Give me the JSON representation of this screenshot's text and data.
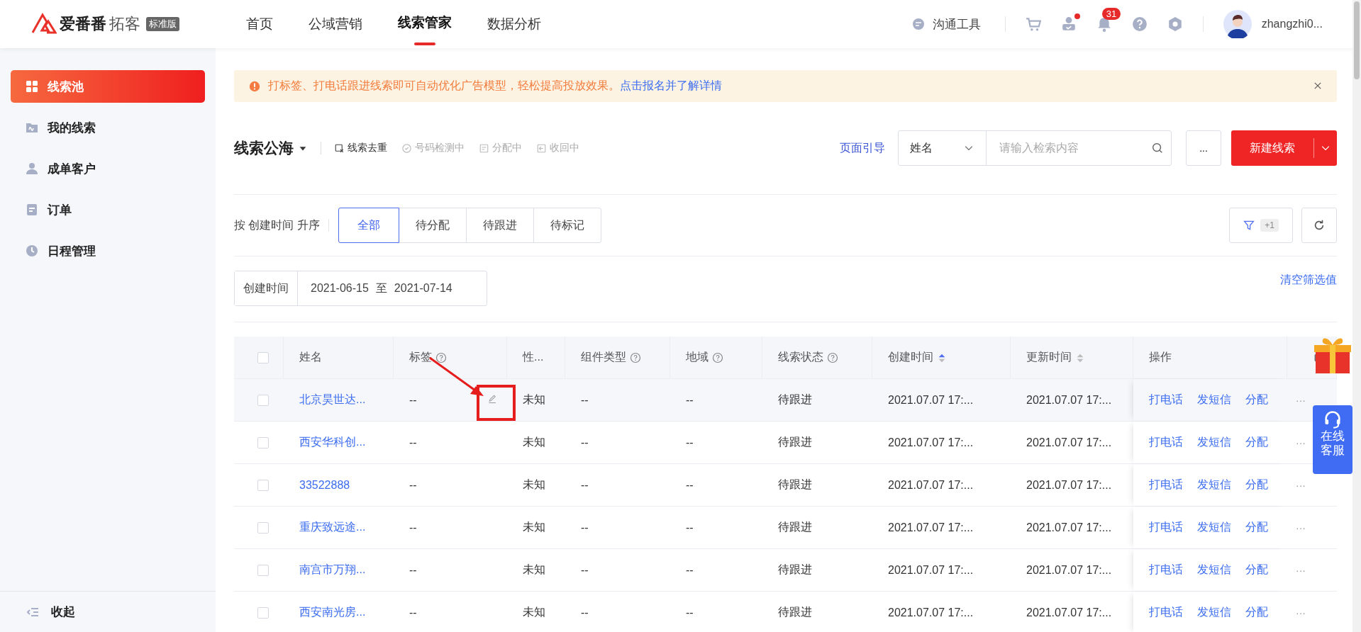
{
  "header": {
    "logo": {
      "brand": "爱番番",
      "product": "拓客",
      "edition": "标准版"
    },
    "nav": [
      {
        "label": "首页",
        "selected": false
      },
      {
        "label": "公域营销",
        "selected": false
      },
      {
        "label": "线索管家",
        "selected": true
      },
      {
        "label": "数据分析",
        "selected": false
      }
    ],
    "comm_tool": "沟通工具",
    "notification_count": "31",
    "user_dot": true,
    "user": "zhangzhi0..."
  },
  "sidebar": {
    "items": [
      {
        "label": "线索池",
        "selected": true
      },
      {
        "label": "我的线索",
        "selected": false
      },
      {
        "label": "成单客户",
        "selected": false
      },
      {
        "label": "订单",
        "selected": false
      },
      {
        "label": "日程管理",
        "selected": false
      }
    ],
    "collapse": "收起"
  },
  "alert": {
    "text": "打标签、打电话跟进线索即可自动优化广告模型，轻松提高投放效果。",
    "link": "点击报名并了解详情"
  },
  "toolbar": {
    "title": "线索公海",
    "actions": [
      {
        "label": "线索去重",
        "disabled": false
      },
      {
        "label": "号码检测中",
        "disabled": true
      },
      {
        "label": "分配中",
        "disabled": true
      },
      {
        "label": "收回中",
        "disabled": true
      }
    ],
    "guide": "页面引导",
    "search": {
      "field": "姓名",
      "placeholder": "请输入检索内容"
    },
    "more": "...",
    "create": "新建线索"
  },
  "filters": {
    "sort_label": "按 创建时间 升序",
    "tabs": [
      {
        "label": "全部",
        "selected": true
      },
      {
        "label": "待分配",
        "selected": false
      },
      {
        "label": "待跟进",
        "selected": false
      },
      {
        "label": "待标记",
        "selected": false
      }
    ],
    "filter_count": "+1"
  },
  "date_filter": {
    "label": "创建时间",
    "start": "2021-06-15",
    "separator": "至",
    "end": "2021-07-14",
    "clear": "清空筛选值"
  },
  "table": {
    "select_all": false,
    "columns": [
      {
        "label": "姓名"
      },
      {
        "label": "标签",
        "help": true
      },
      {
        "label": "性..."
      },
      {
        "label": "组件类型",
        "help": true
      },
      {
        "label": "地域",
        "help": true
      },
      {
        "label": "线索状态",
        "help": true
      },
      {
        "label": "创建时间",
        "sortable": true,
        "sorted": true
      },
      {
        "label": "更新时间",
        "sortable": true,
        "sorted": false
      },
      {
        "label": "操作"
      }
    ],
    "rows": [
      {
        "checked": false,
        "hovered": true,
        "cells": [
          "北京昊世达...",
          "--",
          "未知",
          "--",
          "--",
          "待跟进",
          "2021.07.07 17:...",
          "2021.07.07 17:..."
        ],
        "actions": [
          "打电话",
          "发短信",
          "分配"
        ],
        "more": "···"
      },
      {
        "checked": false,
        "hovered": false,
        "cells": [
          "西安华科创...",
          "--",
          "未知",
          "--",
          "--",
          "待跟进",
          "2021.07.07 17:...",
          "2021.07.07 17:..."
        ],
        "actions": [
          "打电话",
          "发短信",
          "分配"
        ],
        "more": "···"
      },
      {
        "checked": false,
        "hovered": false,
        "cells": [
          "33522888",
          "--",
          "未知",
          "--",
          "--",
          "待跟进",
          "2021.07.07 17:...",
          "2021.07.07 17:..."
        ],
        "actions": [
          "打电话",
          "发短信",
          "分配"
        ],
        "more": "···"
      },
      {
        "checked": false,
        "hovered": false,
        "cells": [
          "重庆致远途...",
          "--",
          "未知",
          "--",
          "--",
          "待跟进",
          "2021.07.07 17:...",
          "2021.07.07 17:..."
        ],
        "actions": [
          "打电话",
          "发短信",
          "分配"
        ],
        "more": "···"
      },
      {
        "checked": false,
        "hovered": false,
        "cells": [
          "南宫市万翔...",
          "--",
          "未知",
          "--",
          "--",
          "待跟进",
          "2021.07.07 17:...",
          "2021.07.07 17:..."
        ],
        "actions": [
          "打电话",
          "发短信",
          "分配"
        ],
        "more": "···"
      },
      {
        "checked": false,
        "hovered": false,
        "cells": [
          "西安南光房...",
          "--",
          "未知",
          "--",
          "--",
          "待跟进",
          "2021.07.07 17:...",
          "2021.07.07 17:..."
        ],
        "actions": [
          "打电话",
          "发短信",
          "分配"
        ],
        "more": "···"
      }
    ]
  },
  "service": "在线客服"
}
